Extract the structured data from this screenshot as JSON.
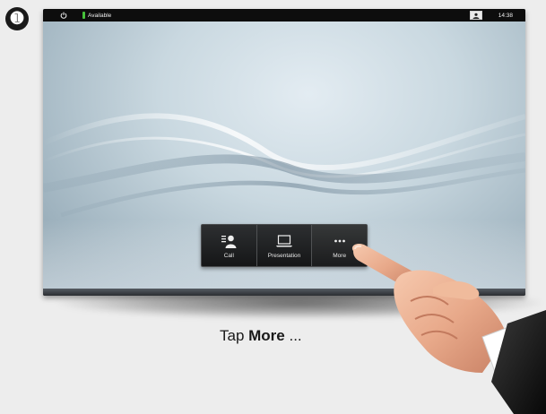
{
  "step": {
    "number": "➊"
  },
  "statusbar": {
    "status": "Available",
    "time": "14:38",
    "status_color": "#46c13a"
  },
  "softkeys": [
    {
      "label": "Call",
      "icon": "call-icon"
    },
    {
      "label": "Presentation",
      "icon": "laptop-icon"
    },
    {
      "label": "More",
      "icon": "more-icon"
    }
  ],
  "caption": {
    "prefix": "Tap ",
    "emphasis": "More",
    "suffix": " ..."
  }
}
